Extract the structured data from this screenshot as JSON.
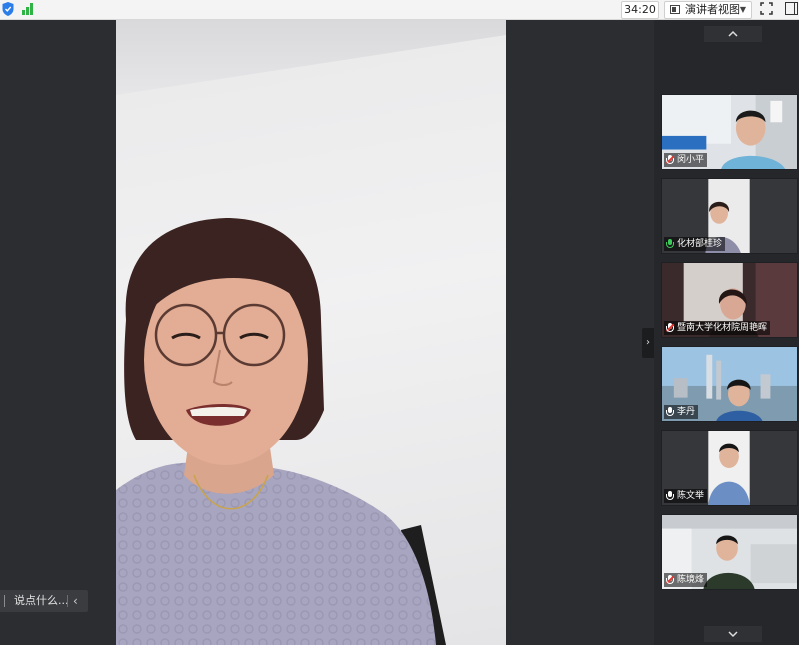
{
  "toolbar": {
    "timer": "34:20",
    "view_mode_label": "演讲者视图",
    "icons": [
      "shield-icon",
      "signal-icon",
      "layout-icon",
      "chevron-down-icon",
      "fullscreen-icon",
      "sidebar-panel-icon"
    ],
    "colors": {
      "signal": "#2fb344",
      "shield": "#2b7de9"
    }
  },
  "chat": {
    "placeholder": "说点什么...",
    "collapse_arrow": "‹"
  },
  "panel": {
    "collapse_arrow": "›",
    "scroll_up": "⌃",
    "scroll_down": "⌄"
  },
  "participants": [
    {
      "name": "闵小平",
      "mic": "muted"
    },
    {
      "name": "化材部桂珍",
      "mic": "on"
    },
    {
      "name": "暨南大学化材院周艳晖",
      "mic": "muted"
    },
    {
      "name": "李丹",
      "mic": "white"
    },
    {
      "name": "陈文举",
      "mic": "white"
    },
    {
      "name": "陈境烽",
      "mic": "muted"
    }
  ]
}
